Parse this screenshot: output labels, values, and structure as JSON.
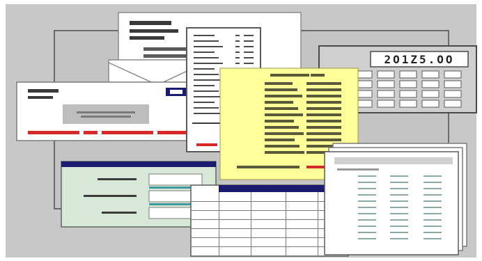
{
  "scene": {
    "background_color": "#c8c8c8",
    "palette": {
      "paper": "#ffffff",
      "ink": "#3a3a3a",
      "light_ink": "#8a8a8a",
      "accent_red": "#d42a2a",
      "accent_navy": "#1a1a6e",
      "yellow_sheet": "#ffff99",
      "green_form": "#d8e8d8",
      "teal_rule": "#3a9a9a",
      "calculator_body": "#d0d0d0",
      "keypad": "#ffffff"
    }
  },
  "calculator": {
    "display_text": "2O1Z5.OO",
    "key_rows": 4,
    "key_cols": 5
  },
  "icon_name": "office-paperwork-clipart"
}
